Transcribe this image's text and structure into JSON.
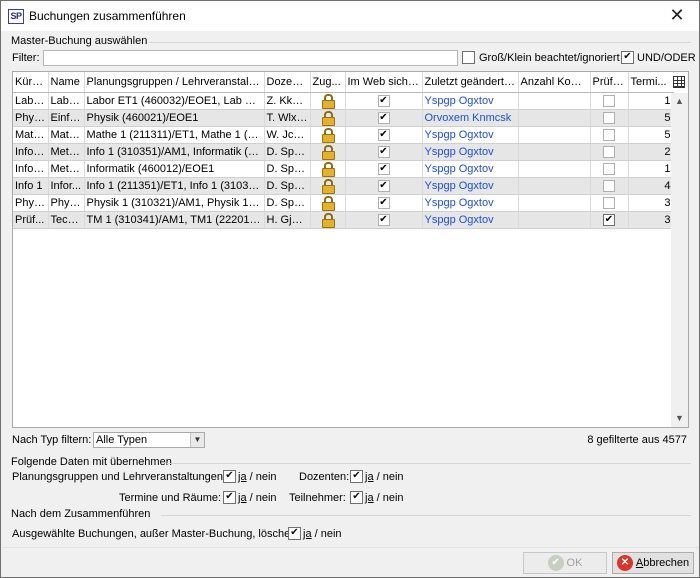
{
  "window": {
    "title": "Buchungen zusammenführen",
    "app_icon_text": "SP"
  },
  "master": {
    "group_label": "Master-Buchung auswählen",
    "filter_label": "Filter:",
    "filter_value": "",
    "case_label": "Groß/Klein beachtet/ignoriert",
    "case_checked": false,
    "andor_label": "UND/ODER",
    "andor_checked": true
  },
  "grid": {
    "columns": [
      "Kürzel",
      "Name",
      "Planungsgruppen / Lehrveranstaltu...",
      "Dozent...",
      "Zug...",
      "Im Web sicht...",
      "Zuletzt geändert ...",
      "Anzahl Konfli...",
      "Prüfu...",
      "Termi..."
    ],
    "rows": [
      {
        "kuerzel": "Labo...",
        "name": "Labo...",
        "gruppen": "Labor ET1 (460032)/EOE1, Lab ET1 ...",
        "dozent": "Z. Kkzh...",
        "locked": true,
        "web": true,
        "geaendert": "Yspgp Ogxtov",
        "konflikte": "",
        "pruefung": false,
        "termine": "1"
      },
      {
        "kuerzel": "Physik",
        "name": "Einfü...",
        "gruppen": "Physik (460021)/EOE1",
        "dozent": "T. Wlxim",
        "locked": true,
        "web": true,
        "geaendert": "Orvoxem Knmcsk",
        "konflikte": "",
        "pruefung": false,
        "termine": "5"
      },
      {
        "kuerzel": "Math...",
        "name": "Math...",
        "gruppen": "Mathe 1 (211311)/ET1, Mathe 1 (46...",
        "dozent": "W. Jccosj",
        "locked": true,
        "web": true,
        "geaendert": "Yspgp Ogxtov",
        "konflikte": "",
        "pruefung": false,
        "termine": "5"
      },
      {
        "kuerzel": "Infor...",
        "name": "Meth...",
        "gruppen": "Info 1 (310351)/AM1, Informatik (46...",
        "dozent": "D. Spyv...",
        "locked": true,
        "web": true,
        "geaendert": "Yspgp Ogxtov",
        "konflikte": "",
        "pruefung": false,
        "termine": "2"
      },
      {
        "kuerzel": "Infor...",
        "name": "Meth...",
        "gruppen": "Informatik (460012)/EOE1",
        "dozent": "D. Spyv...",
        "locked": true,
        "web": true,
        "geaendert": "Yspgp Ogxtov",
        "konflikte": "",
        "pruefung": false,
        "termine": "1"
      },
      {
        "kuerzel": "Info 1",
        "name": "Infor...",
        "gruppen": "Info 1 (211351)/ET1, Info 1 (310351...",
        "dozent": "D. Spyv...",
        "locked": true,
        "web": true,
        "geaendert": "Yspgp Ogxtov",
        "konflikte": "",
        "pruefung": false,
        "termine": "4"
      },
      {
        "kuerzel": "Physi...",
        "name": "Physi...",
        "gruppen": "Physik 1 (310321)/AM1, Physik 1 (21...",
        "dozent": "D. Spyv...",
        "locked": true,
        "web": true,
        "geaendert": "Yspgp Ogxtov",
        "konflikte": "",
        "pruefung": false,
        "termine": "3"
      },
      {
        "kuerzel": "Prüf...",
        "name": "Tech...",
        "gruppen": "TM 1 (310341)/AM1, TM1 (222017)/...",
        "dozent": "H. Gjne...",
        "locked": true,
        "web": true,
        "geaendert": "Yspgp Ogxtov",
        "konflikte": "",
        "pruefung": true,
        "termine": "3"
      }
    ]
  },
  "typ_filter": {
    "label": "Nach Typ filtern:",
    "selected": "Alle Typen"
  },
  "count_text": "8 gefilterte aus 4577",
  "uebernehmen": {
    "group_label": "Folgende Daten mit übernehmen",
    "planungsgruppen_label": "Planungsgruppen und Lehrveranstaltungen:",
    "dozenten_label": "Dozenten:",
    "termine_label": "Termine und Räume:",
    "teilnehmer_label": "Teilnehmer:",
    "ja_text": "ja",
    "nein_text": " / nein"
  },
  "nach": {
    "group_label": "Nach dem Zusammenführen",
    "loeschen_label": "Ausgewählte Buchungen, außer Master-Buchung, löschen:"
  },
  "buttons": {
    "ok_label": "OK",
    "abbrechen_prefix": "A",
    "abbrechen_rest": "bbrechen"
  }
}
